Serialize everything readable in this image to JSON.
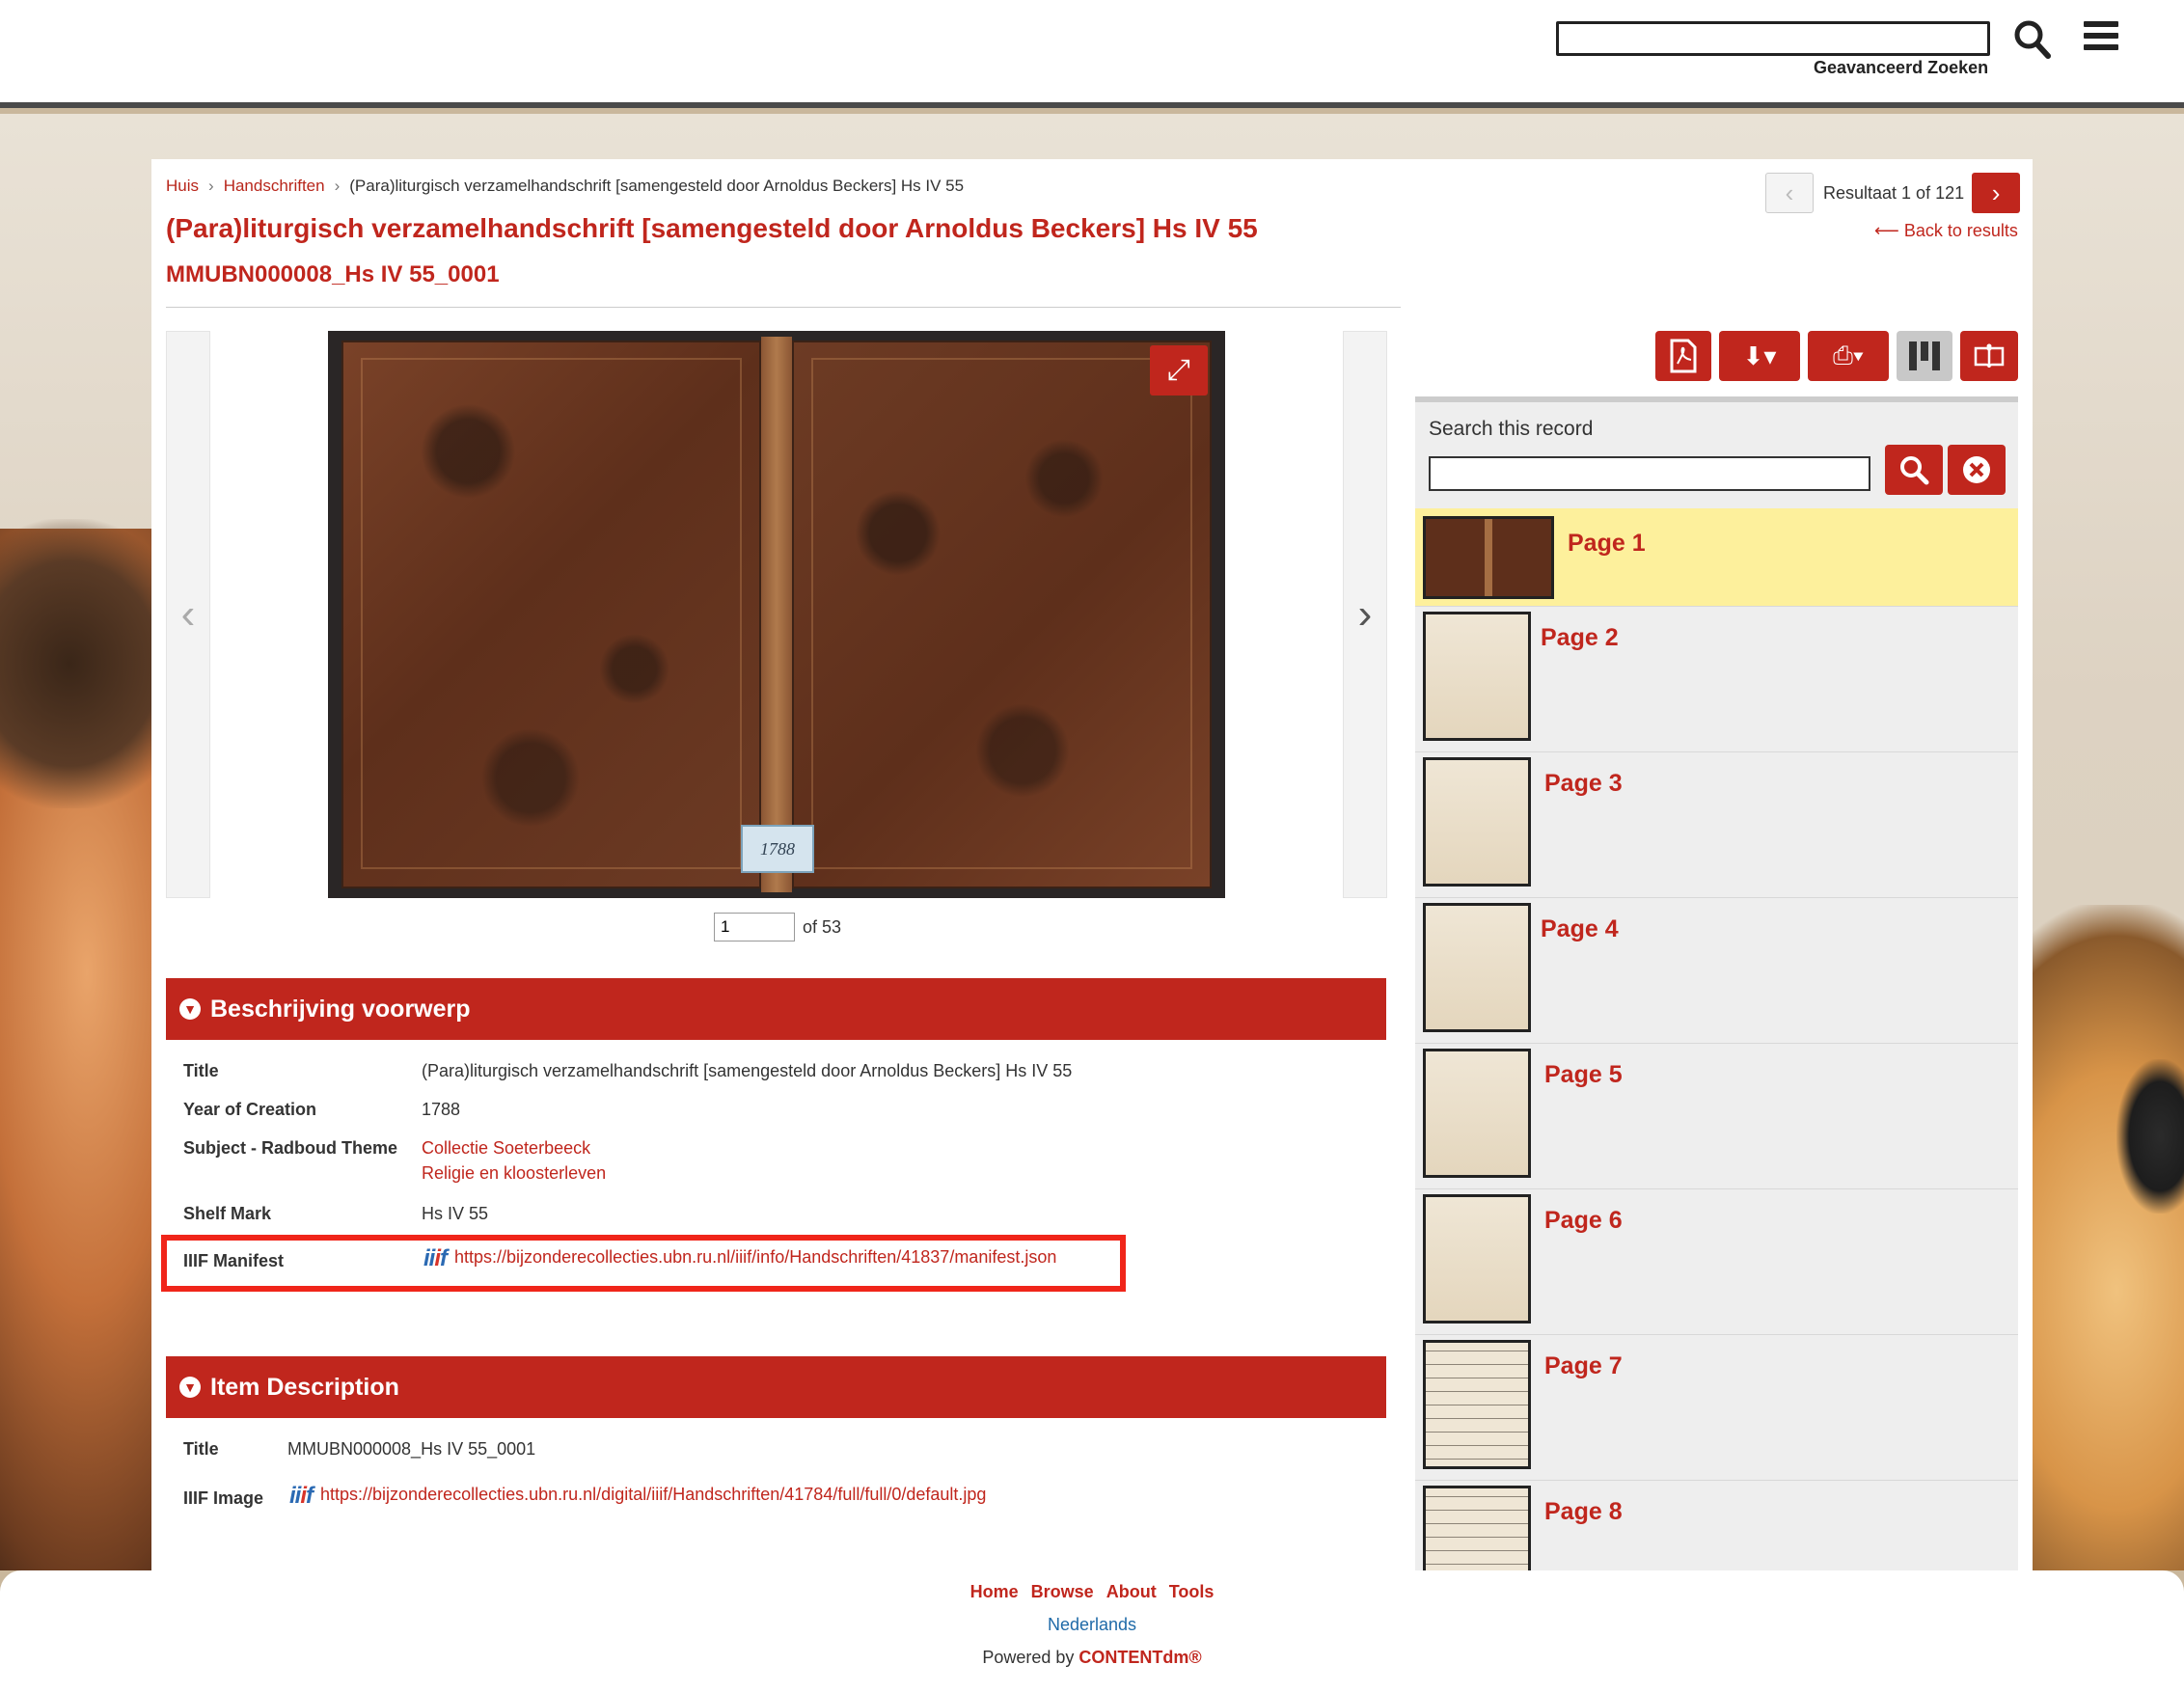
{
  "header": {
    "search_value": "",
    "advanced_search_label": "Geavanceerd Zoeken"
  },
  "breadcrumb": {
    "home": "Huis",
    "collection": "Handschriften",
    "current": "(Para)liturgisch verzamelhandschrift [samengesteld door Arnoldus Beckers] Hs IV 55"
  },
  "item": {
    "title": "(Para)liturgisch verzamelhandschrift [samengesteld door Arnoldus Beckers] Hs IV 55",
    "subtitle": "MMUBN000008_Hs IV 55_0001"
  },
  "pager": {
    "result_text": "Resultaat 1 of 121",
    "back_label": "Back to results"
  },
  "viewer": {
    "page_value": "1",
    "page_total": "of 53",
    "spine_label": "1788",
    "colors": {
      "accent": "#c0261d",
      "highlight": "#fdf09c"
    }
  },
  "description": {
    "heading": "Beschrijving voorwerp",
    "title_label": "Title",
    "title_value": "(Para)liturgisch verzamelhandschrift [samengesteld door Arnoldus Beckers] Hs IV 55",
    "year_label": "Year of Creation",
    "year_value": "1788",
    "subject_label": "Subject - Radboud Theme",
    "subject_1": "Collectie Soeterbeeck",
    "subject_2": "Religie en kloosterleven",
    "shelf_label": "Shelf Mark",
    "shelf_value": "Hs IV 55",
    "iiif_label": "IIIF Manifest",
    "iiif_url": "https://bijzonderecollecties.ubn.ru.nl/iiif/info/Handschriften/41837/manifest.json"
  },
  "item_description": {
    "heading": "Item Description",
    "title_label": "Title",
    "title_value": "MMUBN000008_Hs IV 55_0001",
    "image_label": "IIIF Image",
    "image_url": "https://bijzonderecollecties.ubn.ru.nl/digital/iiif/Handschriften/41784/full/full/0/default.jpg"
  },
  "record_search": {
    "label": "Search this record",
    "value": ""
  },
  "pages": [
    {
      "label": "Page 1"
    },
    {
      "label": "Page 2"
    },
    {
      "label": "Page 3"
    },
    {
      "label": "Page 4"
    },
    {
      "label": "Page 5"
    },
    {
      "label": "Page 6"
    },
    {
      "label": "Page 7"
    },
    {
      "label": "Page 8"
    }
  ],
  "footer": {
    "home": "Home",
    "browse": "Browse",
    "about": "About",
    "tools": "Tools",
    "language": "Nederlands",
    "powered_prefix": "Powered by",
    "powered_brand": "CONTENTdm®"
  },
  "icons": [
    "search-icon",
    "menu-icon",
    "chevron-left-icon",
    "chevron-right-icon",
    "arrow-left-icon",
    "fullscreen-icon",
    "pdf-icon",
    "download-icon",
    "print-icon",
    "grid-icon",
    "book-icon",
    "clear-icon",
    "iiif-logo"
  ]
}
